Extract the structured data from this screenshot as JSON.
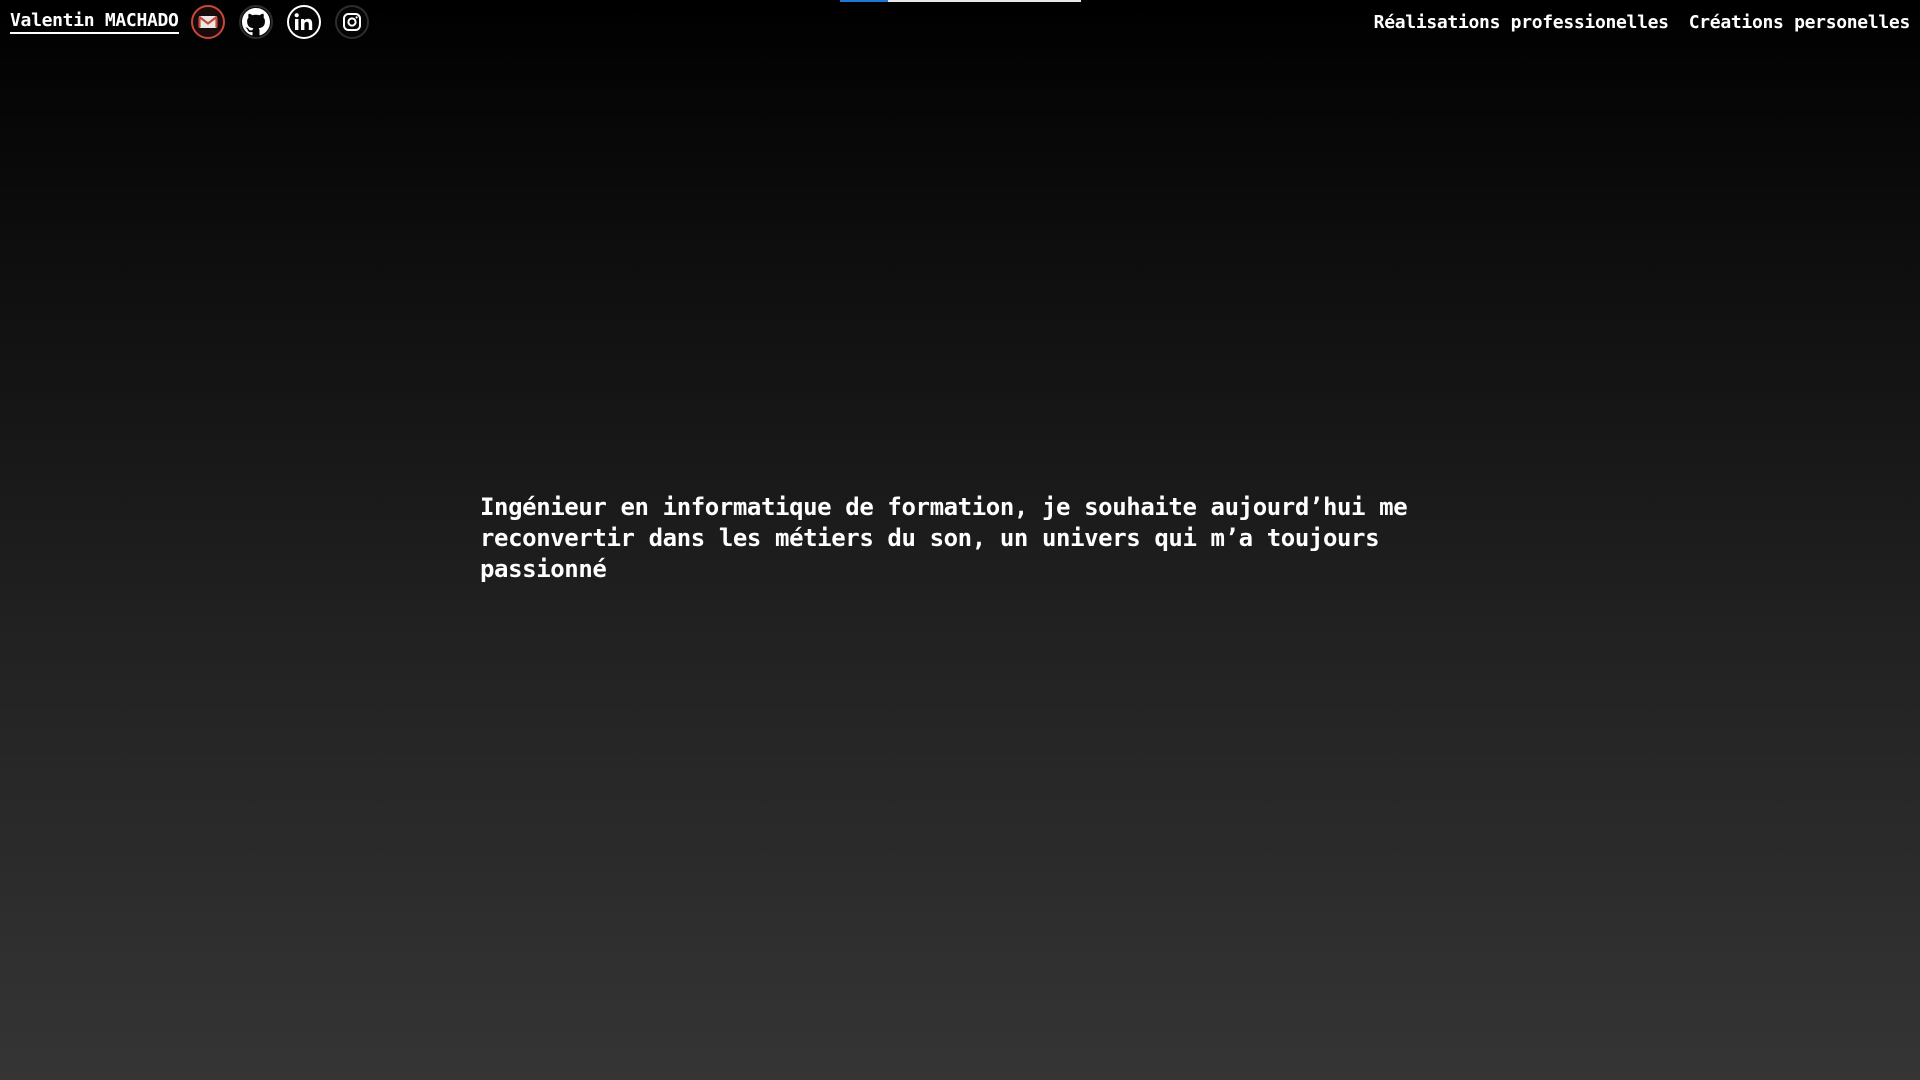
{
  "header": {
    "name": "Valentin MACHADO",
    "social_links": [
      {
        "icon": "mail-icon",
        "label": "Email"
      },
      {
        "icon": "github-icon",
        "label": "GitHub"
      },
      {
        "icon": "linkedin-icon",
        "label": "LinkedIn"
      },
      {
        "icon": "instagram-icon",
        "label": "Instagram"
      }
    ],
    "nav": {
      "professional": "Réalisations professionelles",
      "personal": "Créations personelles"
    }
  },
  "progress": {
    "fraction": 0.2
  },
  "main": {
    "intro": "Ingénieur en informatique de formation, je souhaite aujourd’hui me reconvertir dans les métiers du son, un univers qui m’a toujours passionné"
  },
  "colors": {
    "accent": "#1e78d4",
    "mail": "#c9463d",
    "background_top": "#000000",
    "background_bottom": "#353535",
    "text": "#ffffff"
  }
}
